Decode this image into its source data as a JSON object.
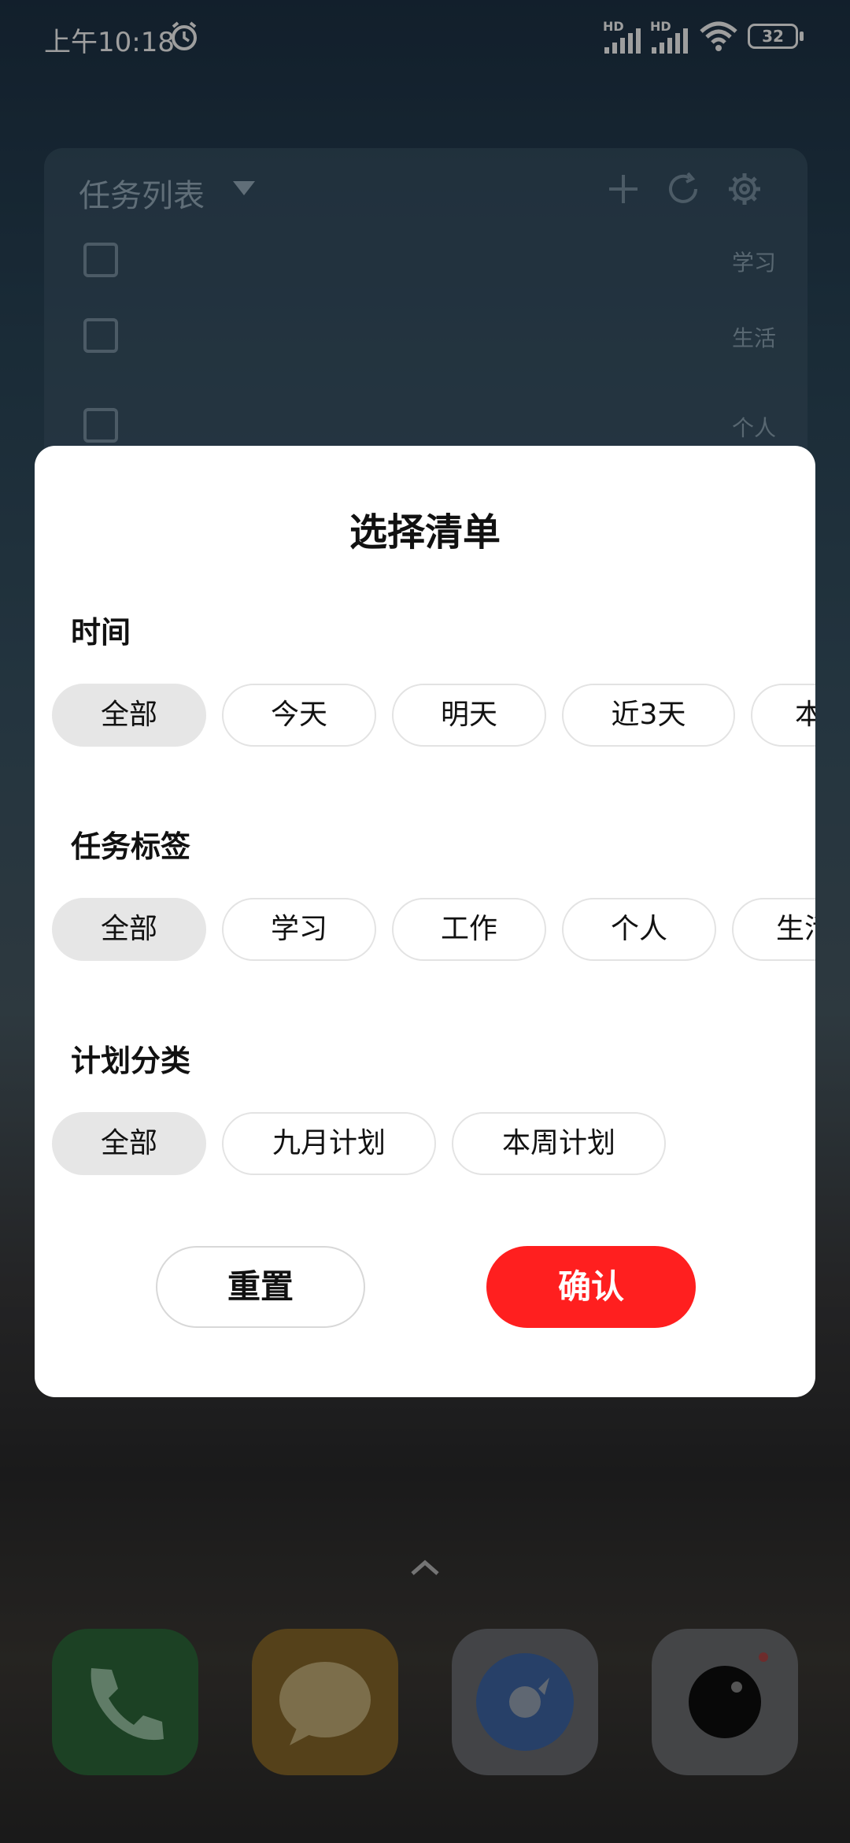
{
  "status_bar": {
    "time": "上午10:18",
    "signal1_label": "HD",
    "signal2_label": "HD",
    "battery": "32"
  },
  "widget": {
    "title": "任务列表",
    "rows": [
      {
        "tag": "学习"
      },
      {
        "tag": "生活"
      },
      {
        "tag": "个人"
      }
    ]
  },
  "dialog": {
    "title": "选择清单",
    "sections": [
      {
        "label": "时间",
        "chips": [
          "全部",
          "今天",
          "明天",
          "近3天",
          "本"
        ]
      },
      {
        "label": "任务标签",
        "chips": [
          "全部",
          "学习",
          "工作",
          "个人",
          "生活"
        ]
      },
      {
        "label": "计划分类",
        "chips": [
          "全部",
          "九月计划",
          "本周计划"
        ]
      }
    ],
    "reset_label": "重置",
    "confirm_label": "确认"
  },
  "colors": {
    "confirm": "#ff1f1f",
    "selected_chip": "#e6e6e6"
  },
  "icons": [
    "alarm-icon",
    "wifi-icon",
    "add-icon",
    "refresh-icon",
    "gear-icon",
    "phone-icon",
    "message-icon",
    "browser-icon",
    "camera-icon",
    "chevron-up-icon"
  ]
}
